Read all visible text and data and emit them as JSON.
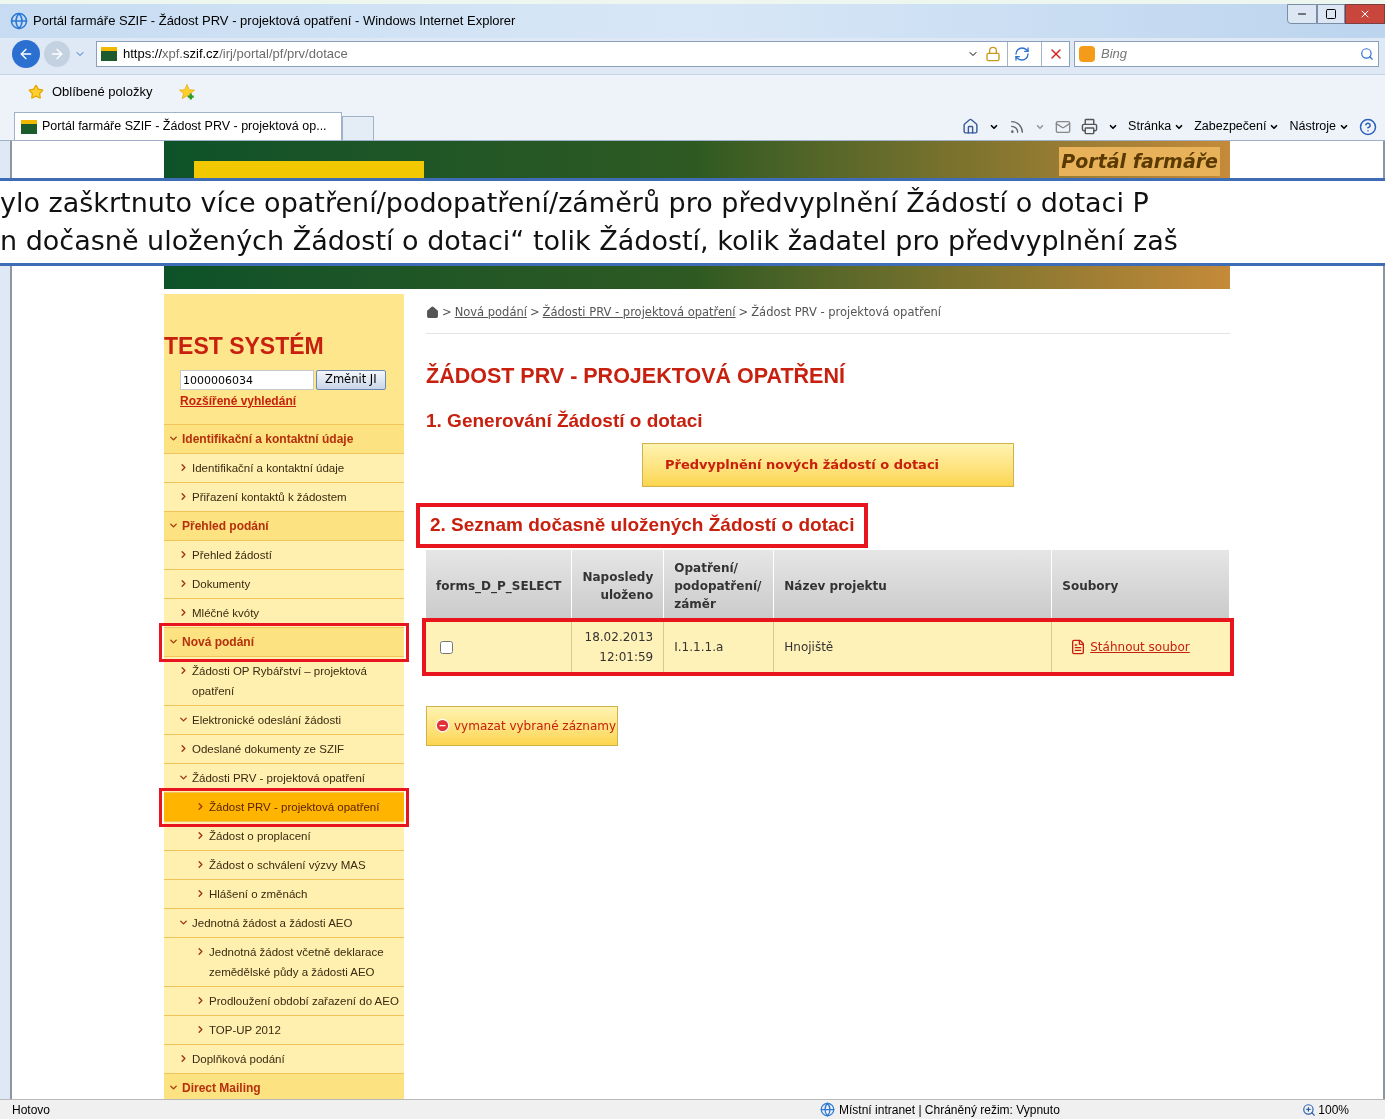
{
  "window": {
    "title": "Portál farmáře SZIF - Žádost PRV - projektová opatření - Windows Internet Explorer"
  },
  "address_bar": {
    "segments": [
      {
        "text": "https://",
        "emphasis": true
      },
      {
        "text": "xpf.",
        "emphasis": false
      },
      {
        "text": "szif.cz",
        "emphasis": true
      },
      {
        "text": "/irj/portal/pf/prv/dotace",
        "emphasis": false
      }
    ]
  },
  "search": {
    "placeholder": "Bing"
  },
  "favorites_bar": {
    "label": "Oblíbené položky"
  },
  "tabs": [
    {
      "label": "Portál farmáře SZIF - Žádost PRV - projektová op...",
      "selected": true
    }
  ],
  "command_bar": [
    "Stránka",
    "Zabezpečení",
    "Nástroje"
  ],
  "site_header": {
    "title": "Portál farmáře"
  },
  "overlay_note": {
    "lines": [
      "ylo zaškrtnuto více opatření/podopatření/záměrů pro předvyplnění Žádostí o dotaci P",
      "n dočasně uložených Žádostí o dotaci“ tolik Žádostí, kolik žadatel pro předvyplnění zaš"
    ]
  },
  "sidebar": {
    "title": "TEST SYSTÉM",
    "id_field": {
      "value": "1000006034"
    },
    "change_button": "Změnit JI",
    "advanced_search_link": "Rozšířené vyhledání",
    "items": [
      {
        "kind": "section",
        "label": "Identifikační a kontaktní údaje",
        "expanded": true,
        "selected": false,
        "annotated": false,
        "children": [
          {
            "kind": "link",
            "label": "Identifikační a kontaktní údaje",
            "expanded": false,
            "selected": false,
            "annotated": false
          },
          {
            "kind": "link",
            "label": "Přiřazení kontaktů k žádostem",
            "expanded": false,
            "selected": false,
            "annotated": false
          }
        ]
      },
      {
        "kind": "section",
        "label": "Přehled podání",
        "expanded": true,
        "selected": false,
        "annotated": false,
        "children": [
          {
            "kind": "link",
            "label": "Přehled žádostí",
            "expanded": false,
            "selected": false,
            "annotated": false
          },
          {
            "kind": "link",
            "label": "Dokumenty",
            "expanded": false,
            "selected": false,
            "annotated": false
          },
          {
            "kind": "link",
            "label": "Mléčné kvóty",
            "expanded": false,
            "selected": false,
            "annotated": false
          }
        ]
      },
      {
        "kind": "section",
        "label": "Nová podání",
        "expanded": true,
        "selected": false,
        "annotated": true,
        "children": [
          {
            "kind": "link",
            "label": "Žádosti OP Rybářství – projektová opatření",
            "expanded": false,
            "selected": false,
            "annotated": false
          },
          {
            "kind": "link",
            "label": "Elektronické odeslání žádosti",
            "expanded": true,
            "selected": false,
            "annotated": false
          },
          {
            "kind": "link",
            "label": "Odeslané dokumenty ze SZIF",
            "expanded": false,
            "selected": false,
            "annotated": false
          },
          {
            "kind": "link",
            "label": "Žádosti PRV - projektová opatření",
            "expanded": true,
            "selected": false,
            "annotated": false,
            "children": [
              {
                "kind": "link",
                "label": "Žádost PRV - projektová opatření",
                "expanded": false,
                "selected": true,
                "annotated": true
              },
              {
                "kind": "link",
                "label": "Žádost o proplacení",
                "expanded": false,
                "selected": false,
                "annotated": false
              },
              {
                "kind": "link",
                "label": "Žádost o schválení výzvy MAS",
                "expanded": false,
                "selected": false,
                "annotated": false
              },
              {
                "kind": "link",
                "label": "Hlášení o změnách",
                "expanded": false,
                "selected": false,
                "annotated": false
              }
            ]
          },
          {
            "kind": "link",
            "label": "Jednotná žádost a žádosti AEO",
            "expanded": true,
            "selected": false,
            "annotated": false,
            "children": [
              {
                "kind": "link",
                "label": "Jednotná žádost včetně deklarace zemědělské půdy a žádosti AEO",
                "expanded": false,
                "selected": false,
                "annotated": false
              },
              {
                "kind": "link",
                "label": "Prodloužení období zařazení do AEO",
                "expanded": false,
                "selected": false,
                "annotated": false
              },
              {
                "kind": "link",
                "label": "TOP-UP 2012",
                "expanded": false,
                "selected": false,
                "annotated": false
              }
            ]
          },
          {
            "kind": "link",
            "label": "Doplňková podání",
            "expanded": false,
            "selected": false,
            "annotated": false
          }
        ]
      },
      {
        "kind": "section",
        "label": "Direct Mailing",
        "expanded": true,
        "selected": false,
        "annotated": false
      }
    ]
  },
  "breadcrumb": {
    "links": [
      "Nová podání",
      "Žádosti PRV - projektová opatření"
    ],
    "separators": [
      ">",
      ">",
      ">"
    ],
    "current": "Žádost PRV - projektová opatření"
  },
  "page_title": "ŽÁDOST PRV - PROJEKTOVÁ OPATŘENÍ",
  "section_1": {
    "title": "1. Generování Žádostí o dotaci",
    "button": "Předvyplnění nových žádostí o dotaci"
  },
  "section_2": {
    "title": "2. Seznam dočasně uložených Žádostí o dotaci",
    "annotated": true
  },
  "table": {
    "columns": [
      "forms_D_P_SELECT",
      "Naposledy uloženo",
      "Opatření/ podopatření/ záměr",
      "Název projektu",
      "Soubory"
    ],
    "rows": [
      {
        "checked": false,
        "annotated": true,
        "cells": [
          "",
          "18.02.2013 12:01:59",
          "I.1.1.1.a",
          "Hnojiště",
          "Stáhnout soubor"
        ]
      }
    ]
  },
  "delete_button": "vymazat vybrané záznamy",
  "status_bar": {
    "status": "Hotovo",
    "zone": "Místní intranet | Chráněný režim: Vypnuto",
    "zoom": "100%"
  }
}
